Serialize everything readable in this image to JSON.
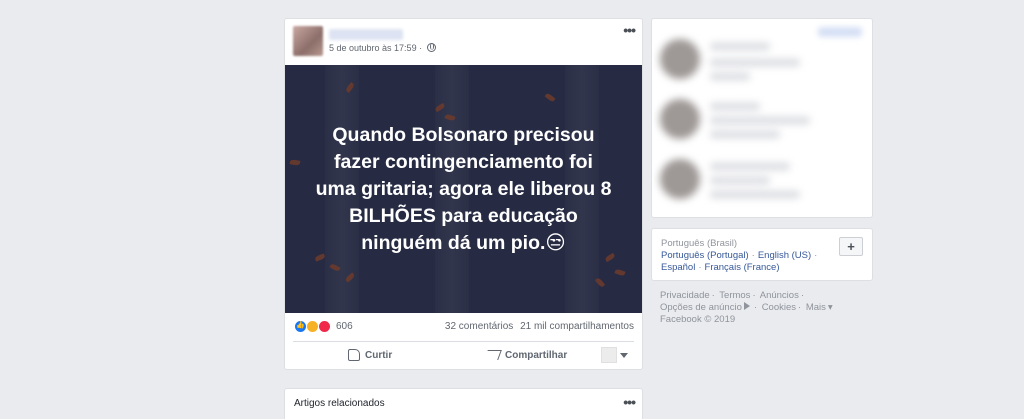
{
  "post": {
    "timestamp": "5 de outubro às 17:59",
    "more_label": "•••",
    "image_text": "Quando Bolsonaro precisou\nfazer contingenciamento foi\numa gritaria; agora ele liberou 8\nBILHÕES para educação\nninguém dá um pio.😒",
    "reaction_count": "606",
    "comments": "32 comentários",
    "shares": "21 mil compartilhamentos",
    "like_label": "Curtir",
    "share_label": "Compartilhar"
  },
  "related": {
    "title": "Artigos relacionados",
    "more_label": "•••"
  },
  "languages": {
    "current": "Português (Brasil)",
    "line1": [
      "Português (Portugal)",
      "English (US)"
    ],
    "line2": [
      "Español",
      "Français (France)"
    ],
    "plus_label": "+"
  },
  "footer": {
    "privacy": "Privacidade",
    "terms": "Termos",
    "ads": "Anúncios",
    "ad_choices": "Opções de anúncio",
    "cookies": "Cookies",
    "more": "Mais",
    "copyright": "Facebook © 2019"
  }
}
